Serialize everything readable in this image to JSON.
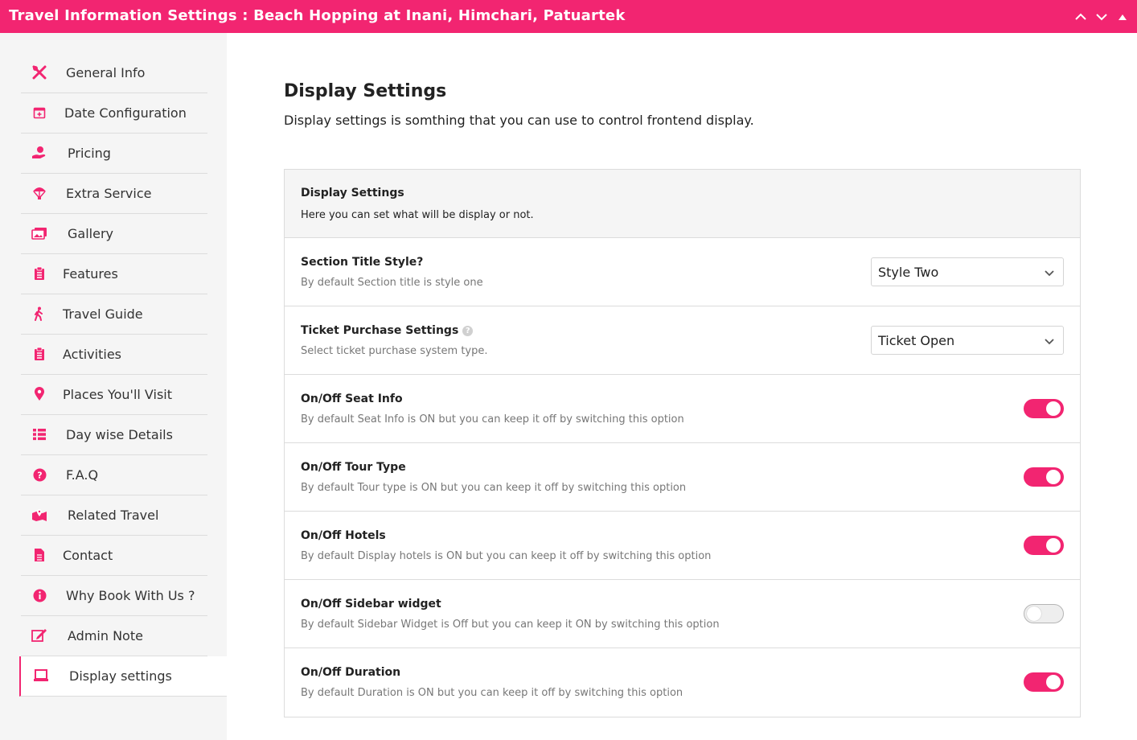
{
  "header": {
    "title": "Travel Information Settings : Beach Hopping at Inani, Himchari, Patuartek",
    "bg_color": "#f22571"
  },
  "sidebar": {
    "items": [
      {
        "label": "General Info",
        "icon": "tools-icon"
      },
      {
        "label": "Date Configuration",
        "icon": "calendar-plus-icon"
      },
      {
        "label": "Pricing",
        "icon": "hand-dollar-icon"
      },
      {
        "label": "Extra Service",
        "icon": "parachute-icon"
      },
      {
        "label": "Gallery",
        "icon": "images-icon"
      },
      {
        "label": "Features",
        "icon": "clipboard-list-icon"
      },
      {
        "label": "Travel Guide",
        "icon": "hiking-icon"
      },
      {
        "label": "Activities",
        "icon": "clipboard-list-icon"
      },
      {
        "label": "Places You'll Visit",
        "icon": "map-marker-icon"
      },
      {
        "label": "Day wise Details",
        "icon": "list-icon"
      },
      {
        "label": "F.A.Q",
        "icon": "question-circle-icon"
      },
      {
        "label": "Related Travel",
        "icon": "map-location-icon"
      },
      {
        "label": "Contact",
        "icon": "file-text-icon"
      },
      {
        "label": "Why Book With Us ?",
        "icon": "info-circle-icon"
      },
      {
        "label": "Admin Note",
        "icon": "edit-icon"
      },
      {
        "label": "Display settings",
        "icon": "laptop-icon"
      }
    ],
    "active_index": 15
  },
  "main": {
    "title": "Display Settings",
    "description": "Display settings is somthing that you can use to control frontend display."
  },
  "panel": {
    "title": "Display Settings",
    "subtitle": "Here you can set what will be display or not.",
    "rows": [
      {
        "title": "Section Title Style?",
        "desc": "By default Section title is style one",
        "control": "select",
        "value": "Style Two"
      },
      {
        "title": "Ticket Purchase Settings",
        "desc": "Select ticket purchase system type.",
        "control": "select",
        "value": "Ticket Open",
        "help": "?"
      },
      {
        "title": "On/Off Seat Info",
        "desc": "By default Seat Info is ON but you can keep it off by switching this option",
        "control": "toggle",
        "on": true
      },
      {
        "title": "On/Off Tour Type",
        "desc": "By default Tour type is ON but you can keep it off by switching this option",
        "control": "toggle",
        "on": true
      },
      {
        "title": "On/Off Hotels",
        "desc": "By default Display hotels is ON but you can keep it off by switching this option",
        "control": "toggle",
        "on": true
      },
      {
        "title": "On/Off Sidebar widget",
        "desc": "By default Sidebar Widget is Off but you can keep it ON by switching this option",
        "control": "toggle",
        "on": false
      },
      {
        "title": "On/Off Duration",
        "desc": "By default Duration is ON but you can keep it off by switching this option",
        "control": "toggle",
        "on": true
      }
    ]
  }
}
